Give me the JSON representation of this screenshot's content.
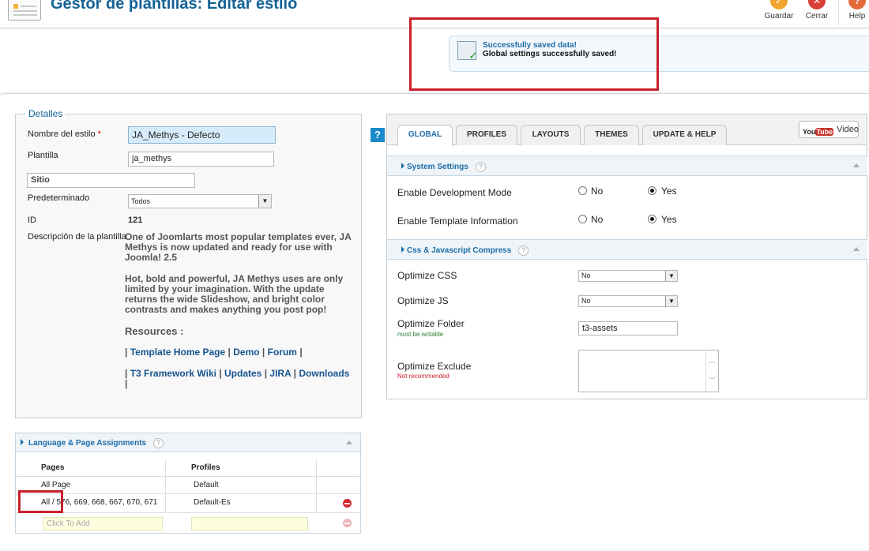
{
  "header": {
    "title": "Gestor de plantillas: Editar estilo",
    "buttons": [
      {
        "label": "Guardar",
        "icon": "save-icon"
      },
      {
        "label": "Cerrar",
        "icon": "close-icon"
      },
      {
        "label": "Help",
        "icon": "help-icon"
      }
    ]
  },
  "message": {
    "title": "Successfully saved data!",
    "text": "Global settings successfully saved!"
  },
  "details": {
    "legend": "Detalles",
    "style_name_label": "Nombre del estilo",
    "required_mark": "*",
    "style_name_value": "JA_Methys - Defecto",
    "template_label": "Plantilla",
    "template_value": "ja_methys",
    "site_value": "Sitio",
    "default_label": "Predeterminado",
    "default_value": "Todos",
    "id_label": "ID",
    "id_value": "121",
    "description_label": "Descripción de la plantilla",
    "description_p1": "One of Joomlarts most popular templates ever, JA Methys is now updated and ready for use with Joomla! 2.5",
    "description_p2": "Hot, bold and powerful, JA Methys uses are only limited by your imagination. With the update returns the wide Slideshow, and bright color contrasts and makes anything you post pop!",
    "resources_title": "Resources :",
    "links_row1": [
      "Template Home Page",
      "Demo",
      "Forum"
    ],
    "links_row2": [
      "T3 Framework Wiki",
      "Updates",
      "JIRA",
      "Downloads"
    ],
    "sep": "|"
  },
  "lang_panel": {
    "title": "Language & Page Assignments",
    "help": "?",
    "columns": [
      "Pages",
      "Profiles"
    ],
    "rows": [
      {
        "page": "All Page",
        "profile": "Default"
      },
      {
        "page": "All / 576, 669, 668, 667, 670, 671",
        "profile": "Default-Es"
      }
    ],
    "add_placeholder": "Click To Add"
  },
  "settings": {
    "tabs": [
      "GLOBAL",
      "PROFILES",
      "LAYOUTS",
      "THEMES",
      "UPDATE & HELP"
    ],
    "active_tab": "GLOBAL",
    "video_label": "Video",
    "youtube_you": "You",
    "youtube_tube": "Tube",
    "help_mark": "?",
    "system_section": "System Settings",
    "dev_mode_label": "Enable Development Mode",
    "template_info_label": "Enable Template Information",
    "no_label": "No",
    "yes_label": "Yes",
    "css_js_section": "Css & Javascript Compress",
    "optimize_css_label": "Optimize CSS",
    "optimize_css_value": "No",
    "optimize_js_label": "Optimize JS",
    "optimize_js_value": "No",
    "optimize_folder_label": "Optimize Folder",
    "optimize_folder_note": "must be writable",
    "optimize_folder_value": "t3-assets",
    "optimize_exclude_label": "Optimize Exclude",
    "optimize_exclude_note": "Not recommended"
  },
  "colors": {
    "accent": "#146295",
    "highlight_red": "#c8202c",
    "note_green": "#2e7d32",
    "note_red": "#c8202c"
  }
}
